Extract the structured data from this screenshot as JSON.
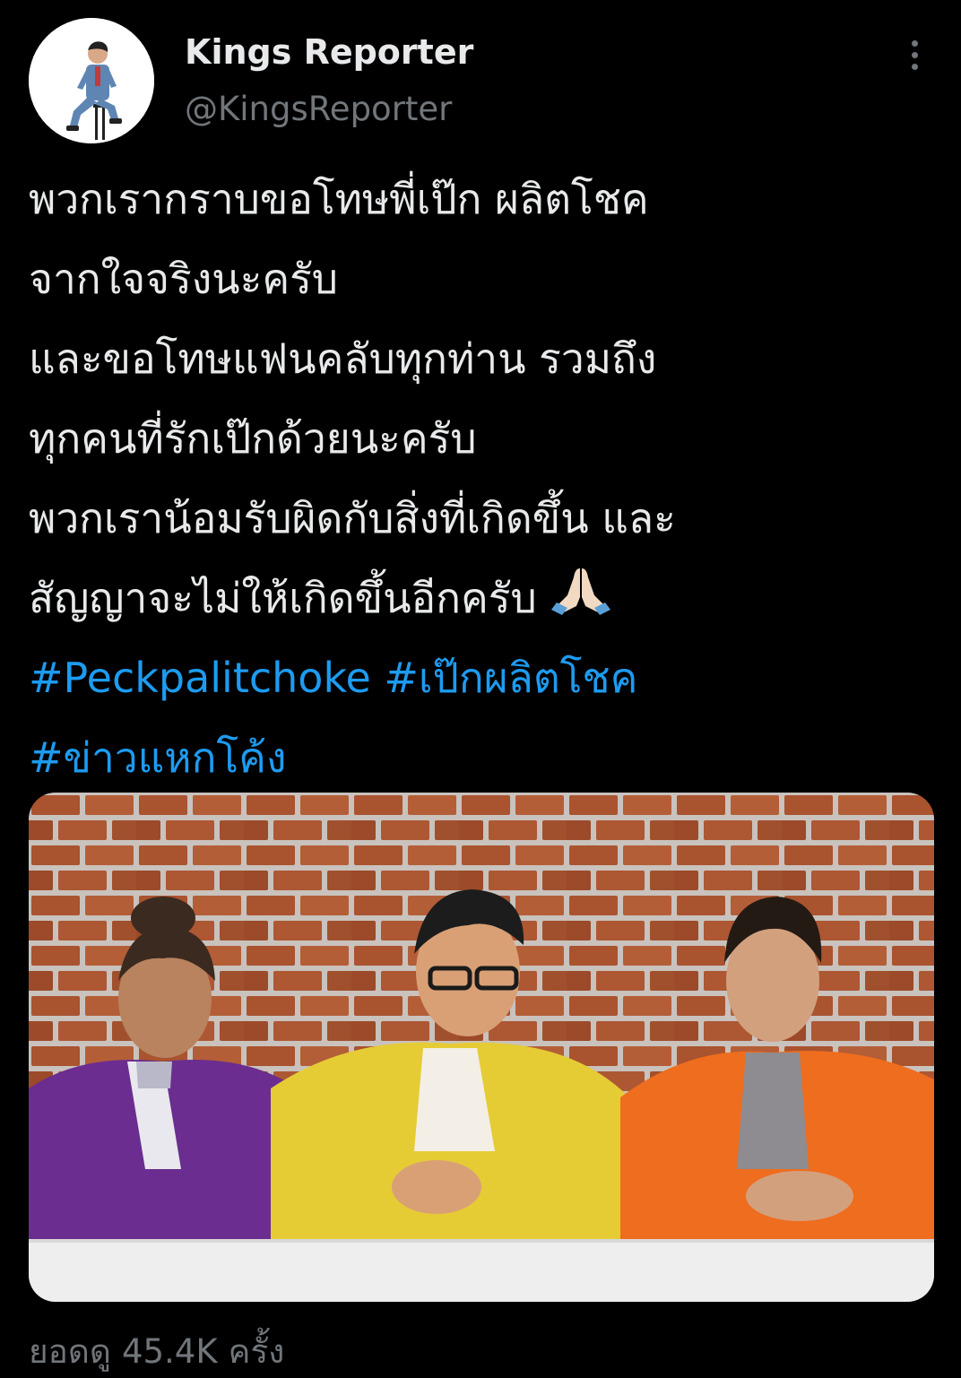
{
  "author": {
    "display_name": "Kings Reporter",
    "handle": "@KingsReporter",
    "avatar_icon": "profile-photo",
    "more_icon": "more-vertical-icon"
  },
  "tweet": {
    "lines": [
      "พวกเรากราบขอโทษพี่เป๊ก ผลิตโชค",
      "จากใจจริงนะครับ",
      "และขอโทษแฟนคลับทุกท่าน รวมถึง",
      "ทุกคนที่รักเป๊กด้วยนะครับ",
      "พวกเราน้อมรับผิดกับสิ่งที่เกิดขึ้น และ",
      "สัญญาจะไม่ให้เกิดขึ้นอีกครับ"
    ],
    "emoji": "folded-hands",
    "hashtags": [
      "#Peckpalitchoke",
      "#เป๊กผลิตโชค",
      "#ข่าวแหกโค้ง"
    ]
  },
  "media": {
    "type": "photo",
    "subject": "three-people-at-table-brick-wall"
  },
  "stats": {
    "views_label": "ยอดดู",
    "views_count": "45.4K",
    "views_unit": "ครั้ง"
  },
  "colors": {
    "background": "#000000",
    "text": "#e7e9ea",
    "secondary": "#71767b",
    "link": "#1d9bf0"
  }
}
